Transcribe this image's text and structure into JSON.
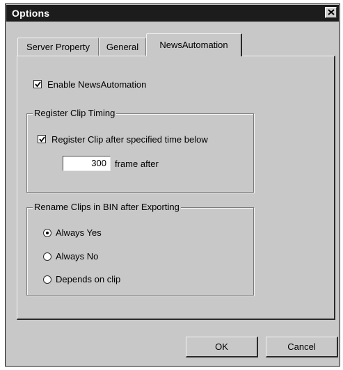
{
  "window": {
    "title": "Options"
  },
  "tabs": [
    {
      "label": "Server Property",
      "active": false
    },
    {
      "label": "General",
      "active": false
    },
    {
      "label": "NewsAutomation",
      "active": true
    }
  ],
  "enable_newsautomation": {
    "label": "Enable NewsAutomation",
    "checked": true
  },
  "register_clip_timing": {
    "group_label": "Register Clip Timing",
    "checkbox": {
      "label": "Register Clip after specified time below",
      "checked": true
    },
    "frames_value": "300",
    "frames_suffix": "frame after"
  },
  "rename_clips": {
    "group_label": "Rename Clips in BIN after Exporting",
    "options": [
      {
        "label": "Always Yes",
        "selected": true
      },
      {
        "label": "Always No",
        "selected": false
      },
      {
        "label": "Depends on clip",
        "selected": false
      }
    ]
  },
  "buttons": {
    "ok": "OK",
    "cancel": "Cancel"
  },
  "colors": {
    "dialog_bg": "#c8c8c8",
    "titlebar_bg": "#1c1c1c",
    "title_text": "#ffffff"
  }
}
